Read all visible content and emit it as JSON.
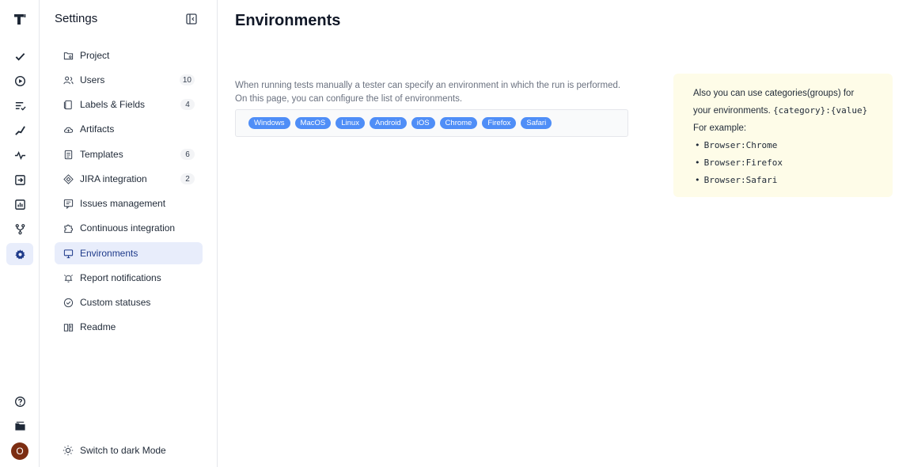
{
  "app": {
    "logo_text": "T"
  },
  "rail": {
    "items": [
      {
        "icon": "check-icon",
        "active": false
      },
      {
        "icon": "play-circle-icon",
        "active": false
      },
      {
        "icon": "list-check-icon",
        "active": false
      },
      {
        "icon": "steps-icon",
        "active": false
      },
      {
        "icon": "pulse-icon",
        "active": false
      },
      {
        "icon": "import-icon",
        "active": false
      },
      {
        "icon": "bar-chart-icon",
        "active": false
      },
      {
        "icon": "branch-icon",
        "active": false
      },
      {
        "icon": "gear-icon",
        "active": true
      }
    ],
    "bottom": [
      {
        "icon": "help-icon"
      },
      {
        "icon": "folder-icon"
      }
    ],
    "avatar_initial": "O"
  },
  "sidebar": {
    "title": "Settings",
    "items": [
      {
        "label": "Project",
        "icon": "project-folder-icon",
        "badge": ""
      },
      {
        "label": "Users",
        "icon": "users-icon",
        "badge": "10"
      },
      {
        "label": "Labels & Fields",
        "icon": "labels-icon",
        "badge": "4"
      },
      {
        "label": "Artifacts",
        "icon": "cloud-upload-icon",
        "badge": ""
      },
      {
        "label": "Templates",
        "icon": "template-icon",
        "badge": "6"
      },
      {
        "label": "JIRA integration",
        "icon": "jira-icon",
        "badge": "2"
      },
      {
        "label": "Issues management",
        "icon": "issues-icon",
        "badge": ""
      },
      {
        "label": "Continuous integration",
        "icon": "puzzle-icon",
        "badge": ""
      },
      {
        "label": "Environments",
        "icon": "monitor-icon",
        "badge": "",
        "active": true
      },
      {
        "label": "Report notifications",
        "icon": "bell-icon",
        "badge": ""
      },
      {
        "label": "Custom statuses",
        "icon": "check-circle-icon",
        "badge": ""
      },
      {
        "label": "Readme",
        "icon": "book-icon",
        "badge": ""
      }
    ],
    "dark_mode_label": "Switch to dark Mode"
  },
  "main": {
    "title": "Environments",
    "description_line1": "When running tests manually a tester can specify an environment in which the run is performed.",
    "description_line2": "On this page, you can configure the list of environments.",
    "environments": [
      "Windows",
      "MacOS",
      "Linux",
      "Android",
      "iOS",
      "Chrome",
      "Firefox",
      "Safari"
    ],
    "tag_color": "#4f8ef7"
  },
  "hint": {
    "line1": "Also you can use categories(groups) for",
    "line2_text": "your environments.",
    "line2_code": "{category}:{value}",
    "line3": "For example:",
    "examples": [
      "Browser:Chrome",
      "Browser:Firefox",
      "Browser:Safari"
    ],
    "bg_color": "#fefce8"
  }
}
